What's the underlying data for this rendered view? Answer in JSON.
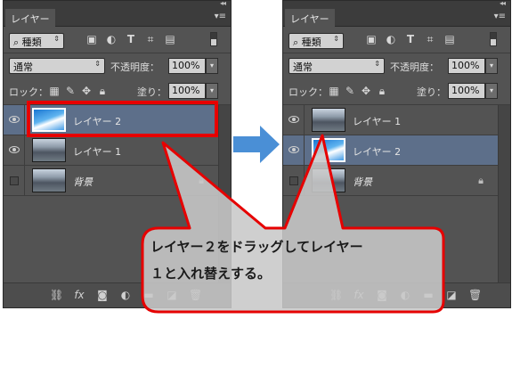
{
  "panels": {
    "left": {
      "tab_title": "レイヤー",
      "filter_kind": "種類",
      "blend_mode": "通常",
      "opacity_label": "不透明度：",
      "opacity_value": "100%",
      "lock_label": "ロック：",
      "fill_label": "塗り：",
      "fill_value": "100%",
      "layers": [
        {
          "name": "レイヤー 2",
          "visible": true,
          "selected": true,
          "thumb": "sky"
        },
        {
          "name": "レイヤー 1",
          "visible": true,
          "selected": false,
          "thumb": "city"
        },
        {
          "name": "背景",
          "visible": false,
          "selected": false,
          "thumb": "city",
          "locked": true
        }
      ]
    },
    "right": {
      "tab_title": "レイヤー",
      "filter_kind": "種類",
      "blend_mode": "通常",
      "opacity_label": "不透明度：",
      "opacity_value": "100%",
      "lock_label": "ロック：",
      "fill_label": "塗り：",
      "fill_value": "100%",
      "layers": [
        {
          "name": "レイヤー 1",
          "visible": true,
          "selected": false,
          "thumb": "city"
        },
        {
          "name": "レイヤー 2",
          "visible": true,
          "selected": true,
          "thumb": "sky"
        },
        {
          "name": "背景",
          "visible": false,
          "selected": false,
          "thumb": "city",
          "locked": true
        }
      ]
    }
  },
  "icons": {
    "filter_icons": [
      "image-filter-icon",
      "adjustment-filter-icon",
      "type-filter-icon",
      "shape-filter-icon",
      "smart-object-filter-icon"
    ],
    "lock_icons": [
      "lock-transparent-icon",
      "lock-paint-icon",
      "lock-move-icon",
      "lock-all-icon"
    ],
    "bottom_icons": [
      "link-layers-icon",
      "fx-icon",
      "mask-icon",
      "adjustment-layer-icon",
      "group-icon",
      "new-layer-icon",
      "trash-icon"
    ]
  },
  "annotation": {
    "callout_line1": "レイヤー２をドラッグしてレイヤー",
    "callout_line2": "１と入れ替えする。",
    "highlight_color": "#e60000",
    "arrow_color": "#4a8fd6"
  }
}
